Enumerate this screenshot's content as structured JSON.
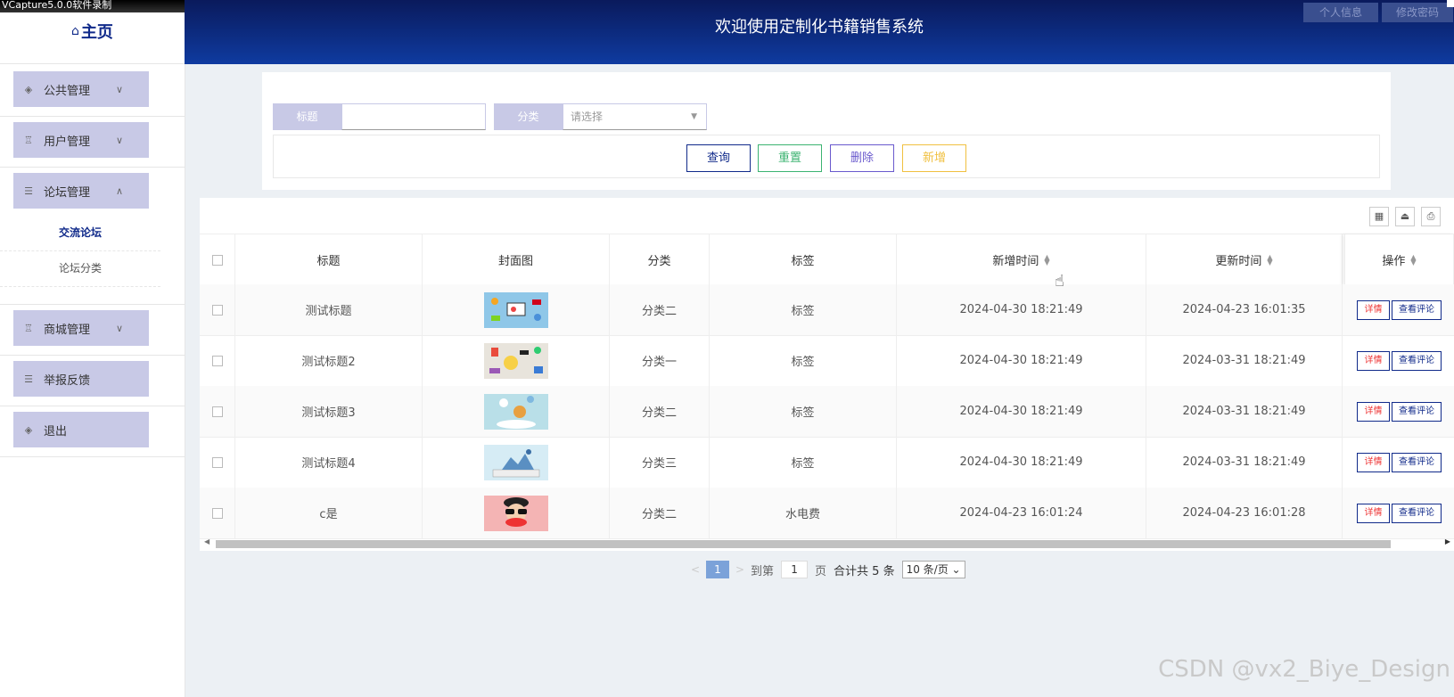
{
  "watermark_top": "VCapture5.0.0软件录制",
  "sidebar": {
    "home": {
      "icon": "home-icon",
      "label": "主页"
    },
    "menus": [
      {
        "label": "公共管理",
        "icon": "layers-icon",
        "expanded": false
      },
      {
        "label": "用户管理",
        "icon": "lamp-icon",
        "expanded": false
      },
      {
        "label": "论坛管理",
        "icon": "list-icon",
        "expanded": true,
        "submenu": [
          {
            "label": "交流论坛",
            "active": true
          },
          {
            "label": "论坛分类",
            "active": false
          }
        ]
      },
      {
        "label": "商城管理",
        "icon": "lamp-icon",
        "expanded": false
      },
      {
        "label": "举报反馈",
        "icon": "list-icon"
      },
      {
        "label": "退出",
        "icon": "layers-icon"
      }
    ]
  },
  "header": {
    "title": "欢迎使用定制化书籍销售系统",
    "profile_label": "个人信息",
    "password_label": "修改密码"
  },
  "search": {
    "title_label": "标题",
    "title_value": "",
    "category_label": "分类",
    "category_placeholder": "请选择",
    "query_button": "查询",
    "reset_button": "重置",
    "delete_button": "删除",
    "add_button": "新增"
  },
  "colors": {
    "header_top": "#0a1a5c",
    "header_bottom": "#0f3ba0",
    "menu_bg": "#c8c9e6",
    "query_border": "#102a8a",
    "reset_border": "#3cb371",
    "delete_border": "#6a5acd",
    "add_border": "#f0c040"
  },
  "table": {
    "columns": [
      "标题",
      "封面图",
      "分类",
      "标签",
      "新增时间",
      "更新时间",
      "操作"
    ],
    "rows": [
      {
        "title": "测试标题",
        "category": "分类二",
        "tag": "标签",
        "created": "2024-04-30 18:21:49",
        "updated": "2024-04-23 16:01:35"
      },
      {
        "title": "测试标题2",
        "category": "分类一",
        "tag": "标签",
        "created": "2024-04-30 18:21:49",
        "updated": "2024-03-31 18:21:49"
      },
      {
        "title": "测试标题3",
        "category": "分类二",
        "tag": "标签",
        "created": "2024-04-30 18:21:49",
        "updated": "2024-03-31 18:21:49"
      },
      {
        "title": "测试标题4",
        "category": "分类三",
        "tag": "标签",
        "created": "2024-04-30 18:21:49",
        "updated": "2024-03-31 18:21:49"
      },
      {
        "title": "c是",
        "category": "分类二",
        "tag": "水电费",
        "created": "2024-04-23 16:01:24",
        "updated": "2024-04-23 16:01:28"
      }
    ],
    "detail_button": "详情",
    "comment_button": "查看评论"
  },
  "pagination": {
    "current_page": "1",
    "goto_label": "到第",
    "goto_value": "1",
    "page_label": "页",
    "total_text": "合计共 5 条",
    "page_size": "10 条/页"
  },
  "csdn_watermark": "CSDN @vx2_Biye_Design"
}
